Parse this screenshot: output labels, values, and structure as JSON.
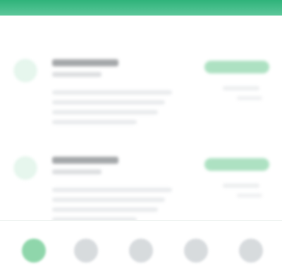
{
  "colors": {
    "accent": "#2fb37a",
    "accent_soft": "#6ac98f",
    "muted": "#c7ccd0",
    "background": "#ffffff"
  },
  "cards": [
    {
      "title": "",
      "subtitle": "",
      "action_label": "",
      "meta_1": "",
      "meta_2": ""
    },
    {
      "title": "",
      "subtitle": "",
      "action_label": "",
      "meta_1": "",
      "meta_2": ""
    }
  ],
  "bottom_nav": [
    {
      "label": "",
      "icon": "home-icon",
      "active": true
    },
    {
      "label": "",
      "icon": "list-icon",
      "active": false
    },
    {
      "label": "",
      "icon": "chat-icon",
      "active": false
    },
    {
      "label": "",
      "icon": "bell-icon",
      "active": false
    },
    {
      "label": "",
      "icon": "profile-icon",
      "active": false
    }
  ]
}
